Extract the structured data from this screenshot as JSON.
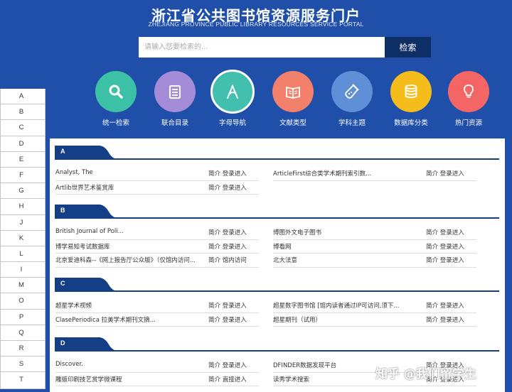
{
  "header": {
    "title": "浙江省公共图书馆资源服务门户",
    "subtitle": "ZHEJIANG PROVINCE PUBLIC LIBRARY RESOURCES SERVICE PORTAL"
  },
  "search": {
    "placeholder": "请输入您要检索的...",
    "button_label": "检索"
  },
  "nav": [
    {
      "label": "统一检索",
      "icon": "search-icon",
      "color": "#3cc0a6"
    },
    {
      "label": "联合目录",
      "icon": "list-icon",
      "color": "#a58cd8"
    },
    {
      "label": "字母导航",
      "icon": "letter-a-icon",
      "color": "#42bfae"
    },
    {
      "label": "文献类型",
      "icon": "book-icon",
      "color": "#f2806a"
    },
    {
      "label": "学科主题",
      "icon": "flask-icon",
      "color": "#5f8fd6"
    },
    {
      "label": "数据库分类",
      "icon": "database-icon",
      "color": "#f4bd1b"
    },
    {
      "label": "热门资源",
      "icon": "lightbulb-icon",
      "color": "#f46565"
    }
  ],
  "alphabet": [
    "A",
    "B",
    "C",
    "D",
    "E",
    "F",
    "G",
    "H",
    "J",
    "K",
    "L",
    "I",
    "M",
    "O",
    "P",
    "Q",
    "R",
    "S",
    "T"
  ],
  "sections": [
    {
      "letter": "A",
      "rows": [
        [
          {
            "name": "Analyst, The",
            "actions": "简介 登录进入"
          },
          {
            "name": "ArticleFirst综合类学术期刊索引数...",
            "actions": "简介 登录进入"
          }
        ],
        [
          {
            "name": "Artlib世界艺术鉴赏库",
            "actions": "简介 登录进入"
          },
          null
        ]
      ]
    },
    {
      "letter": "B",
      "rows": [
        [
          {
            "name": "British Journal of Poli...",
            "actions": "简介 登录进入"
          },
          {
            "name": "博图外文电子图书",
            "actions": "简介 登录进入"
          }
        ],
        [
          {
            "name": "博学易知考试数据库",
            "actions": "简介 登录进入"
          },
          {
            "name": "博看网",
            "actions": "简介 登录进入"
          }
        ],
        [
          {
            "name": "北京爱迪科森--《网上报告厅公众版》（仅馆内访问...",
            "actions": "简介 馆内访问"
          },
          {
            "name": "北大法意",
            "actions": "简介 登录进入"
          }
        ]
      ]
    },
    {
      "letter": "C",
      "rows": [
        [
          {
            "name": "超星学术视频",
            "actions": "简介 登录进入"
          },
          {
            "name": "超星数字图书馆 [馆内读者通过IP可访问,须下...",
            "actions": "简介 登录进入"
          }
        ],
        [
          {
            "name": "ClasePeriodica 拉美学术期刊文摘...",
            "actions": "简介 登录进入"
          },
          {
            "name": "超星期刊（试用）",
            "actions": "简介 登录进入"
          }
        ]
      ]
    },
    {
      "letter": "D",
      "rows": [
        [
          {
            "name": "Discover.",
            "actions": "简介 登录进入"
          },
          {
            "name": "DFINDER数据发现平台",
            "actions": "简介 登录进入"
          }
        ],
        [
          {
            "name": "雕版印刷技艺赏学微课程",
            "actions": "简介 直接进入"
          },
          {
            "name": "读秀学术搜索",
            "actions": "简介 登录进入"
          }
        ]
      ]
    }
  ],
  "watermark": "知乎 @我们留学生"
}
